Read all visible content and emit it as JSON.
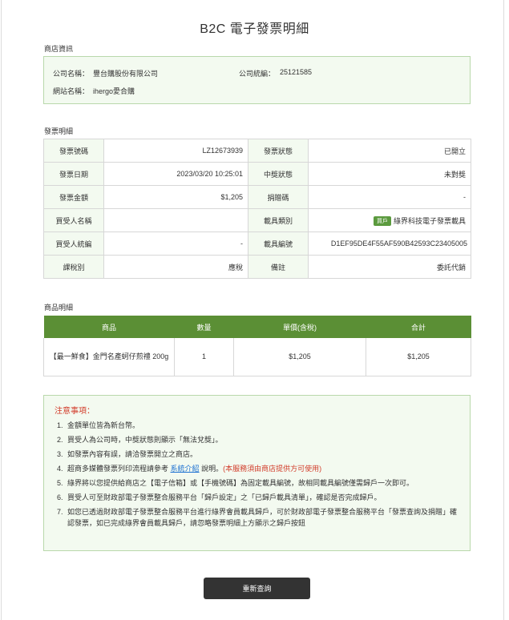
{
  "page_title": "B2C 電子發票明細",
  "store_section": {
    "label": "商店資訊",
    "company_name_label": "公司名稱：",
    "company_name": "豐台購股份有限公司",
    "company_id_label": "公司統編：",
    "company_id": "25121585",
    "site_name_label": "網站名稱：",
    "site_name": "ihergo愛合購"
  },
  "invoice_section": {
    "label": "發票明細",
    "rows": [
      {
        "l1": "發票號碼",
        "v1": "LZ12673939",
        "l2": "發票狀態",
        "v2": "已開立"
      },
      {
        "l1": "發票日期",
        "v1": "2023/03/20 10:25:01",
        "l2": "中獎狀態",
        "v2": "未對獎"
      },
      {
        "l1": "發票金額",
        "v1": "$1,205",
        "l2": "捐贈碼",
        "v2": "-"
      },
      {
        "l1": "買受人名稱",
        "v1": "",
        "l2": "載具類別",
        "v2": "綠界科技電子發票載具",
        "badge": "買戶"
      },
      {
        "l1": "買受人統編",
        "v1": "-",
        "l2": "載具編號",
        "v2": "D1EF95DE4F55AF590B42593C23405005"
      },
      {
        "l1": "課稅別",
        "v1": "應稅",
        "l2": "備註",
        "v2": "委託代銷"
      }
    ]
  },
  "product_section": {
    "label": "商品明細",
    "headers": [
      "商品",
      "數量",
      "單價(含稅)",
      "合計"
    ],
    "items": [
      {
        "name": "【最一鮮食】金門名產蚵仔煎禮 200g",
        "qty": "1",
        "price": "$1,205",
        "total": "$1,205"
      }
    ]
  },
  "notice": {
    "title": "注意事項：",
    "items": [
      {
        "num": "1.",
        "text": "金額單位皆為新台幣。"
      },
      {
        "num": "2.",
        "text": "買受人為公司時，中獎狀態則顯示「無法兌獎」。"
      },
      {
        "num": "3.",
        "text": "如發票內容有誤，請洽發票開立之商店。"
      },
      {
        "num": "4.",
        "text_before": "超商多媒體發票列印流程請參考",
        "link": "系統介紹",
        "text_after": "說明。",
        "red": "(本服務須由商店提供方可使用)"
      },
      {
        "num": "5.",
        "text": "綠界將以您提供給商店之【電子信箱】或【手機號碼】為固定載具編號，故相同載具編號僅需歸戶一次即可。"
      },
      {
        "num": "6.",
        "text": "買受人可至財政部電子發票整合服務平台「歸戶設定」之「已歸戶載具清單」，確認是否完成歸戶。"
      },
      {
        "num": "7.",
        "text": "如您已透過財政部電子發票整合服務平台進行綠界會員載具歸戶，可於財政部電子發票整合服務平台「發票查詢及捐贈」確認發票，如已完成綠界會員載具歸戶，請忽略發票明細上方顯示之歸戶按鈕"
      }
    ]
  },
  "requery_button": "重新查詢"
}
